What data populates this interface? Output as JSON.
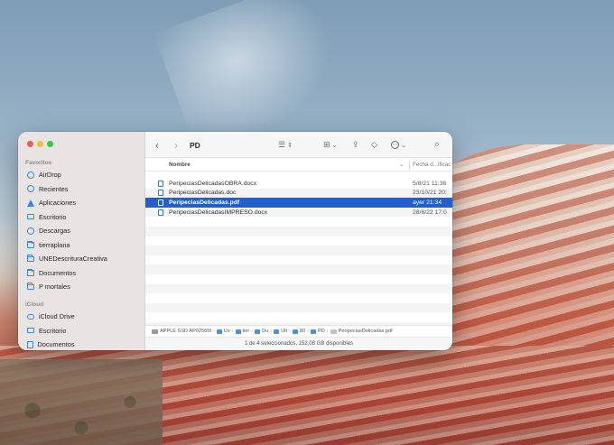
{
  "window": {
    "title": "PD",
    "sidebar": {
      "favorites_header": "Favoritos",
      "favorites": [
        {
          "label": "AirDrop",
          "icon": "airdrop-icon"
        },
        {
          "label": "Recientes",
          "icon": "clock-icon"
        },
        {
          "label": "Aplicaciones",
          "icon": "applications-icon"
        },
        {
          "label": "Escritorio",
          "icon": "desktop-icon"
        },
        {
          "label": "Descargas",
          "icon": "downloads-icon"
        },
        {
          "label": "tierraplana",
          "icon": "folder-icon"
        },
        {
          "label": "UNEDescrituraCreativa",
          "icon": "folder-icon"
        },
        {
          "label": "Documentos",
          "icon": "folder-icon"
        },
        {
          "label": "P mortales",
          "icon": "folder-icon"
        }
      ],
      "icloud_header": "iCloud",
      "icloud": [
        {
          "label": "iCloud Drive",
          "icon": "icloud-icon"
        },
        {
          "label": "Escritorio",
          "icon": "desktop-icon"
        },
        {
          "label": "Documentos",
          "icon": "document-icon"
        }
      ]
    },
    "toolbar": {
      "back": "‹",
      "forward": "›",
      "view_glyph": "☰",
      "sort_glyph": "⇕",
      "grid_glyph": "⊞",
      "share_glyph": "⇪",
      "tag_glyph": "◇",
      "more_glyph": "⋯",
      "search_glyph": "⌕",
      "chevron": "⌄"
    },
    "columns": {
      "name": "Nombre",
      "sort_indicator": "⌄",
      "date": "Fecha d...ificac"
    },
    "files": [
      {
        "name": "PeripeciasDelicadasOBRA.docx",
        "date": "5/8/21 11:36",
        "selected": false
      },
      {
        "name": "PeripeciasDelicadas.doc",
        "date": "23/10/21 20:",
        "selected": false
      },
      {
        "name": "PeripeciasDelicadas.pdf",
        "date": "ayer 21:34",
        "selected": true
      },
      {
        "name": "PeripeciasDelicadasIMPRESO.docx",
        "date": "28/6/22 17:0",
        "selected": false
      }
    ],
    "pathbar": [
      "APPLE SSD AP0256M",
      "Us",
      "tier",
      "Du",
      "Ult",
      "80",
      "PD",
      "PeripeciasDelicadas.pdf"
    ],
    "status": "1 de 4 seleccionados, 152,08 GB disponibles"
  }
}
